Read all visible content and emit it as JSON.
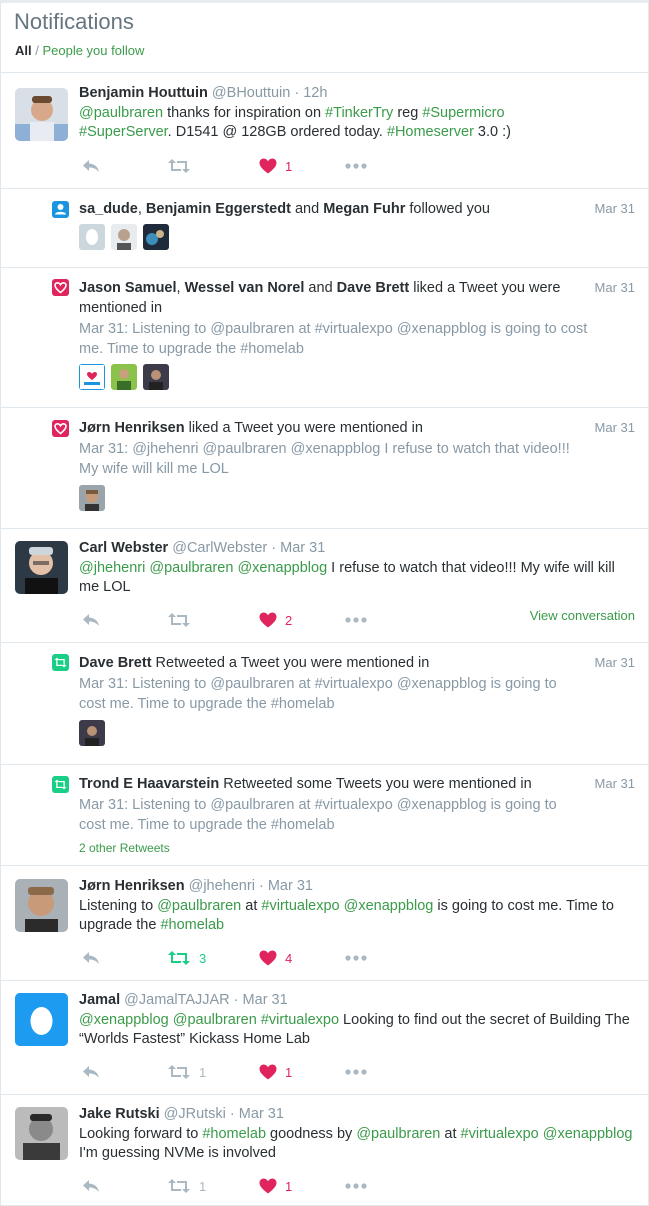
{
  "header": {
    "title": "Notifications",
    "filter_all": "All",
    "filter_sep": " / ",
    "filter_follow": "People you follow"
  },
  "colors": {
    "accent": "#3a9b4a",
    "like": "#e0245e",
    "retweet": "#19cf86",
    "follow": "#1b95e0"
  },
  "tweet1": {
    "name": "Benjamin Houttuin",
    "handle": "@BHouttuin",
    "dot": " · ",
    "time": "12h",
    "t1": "@paulbraren",
    "t2": " thanks for inspiration on ",
    "t3": "#TinkerTry",
    "t4": " reg ",
    "t5": "#Supermicro",
    "t6": "#SuperServer",
    "t7": ". D1541 @ 128GB ordered today. ",
    "t8": "#Homeserver",
    "t9": " 3.0 :)",
    "likes": "1"
  },
  "follow1": {
    "n1": "sa_dude",
    "s1": ", ",
    "n2": "Benjamin Eggerstedt",
    "s2": " and ",
    "n3": "Megan Fuhr",
    "s3": " followed you",
    "date": "Mar 31"
  },
  "like1": {
    "n1": "Jason Samuel",
    "s1": ", ",
    "n2": "Wessel van Norel",
    "s2": " and ",
    "n3": "Dave Brett",
    "s3": " liked a Tweet you were mentioned in",
    "date": "Mar 31",
    "q1": "Mar 31: Listening to ",
    "q2": "@paulbraren",
    "q3": " at ",
    "q4": "#virtualexpo",
    "q5": " ",
    "q6": "@xenappblog",
    "q7": " is going to cost me. Time to upgrade the ",
    "q8": "#homelab"
  },
  "like2": {
    "n1": "Jørn Henriksen",
    "s1": " liked a Tweet you were mentioned in",
    "date": "Mar 31",
    "q1": "Mar 31: ",
    "q2": "@jhehenri",
    "q3": " ",
    "q4": "@paulbraren",
    "q5": " ",
    "q6": "@xenappblog",
    "q7": " I refuse to watch that video!!! My wife will kill me LOL"
  },
  "tweet2": {
    "name": "Carl Webster",
    "handle": "@CarlWebster",
    "dot": " · ",
    "time": "Mar 31",
    "t1": "@jhehenri",
    "t2": " ",
    "t3": "@paulbraren",
    "t4": " ",
    "t5": "@xenappblog",
    "t6": " I refuse to watch that video!!! My wife will kill me LOL",
    "likes": "2",
    "view_conversation": "View conversation"
  },
  "rt1": {
    "n1": "Dave Brett",
    "s1": " Retweeted a Tweet you were mentioned in",
    "date": "Mar 31",
    "q1": "Mar 31: Listening to ",
    "q2": "@paulbraren",
    "q3": " at ",
    "q4": "#virtualexpo",
    "q5": " ",
    "q6": "@xenappblog",
    "q7": " is going to cost me. Time to upgrade the ",
    "q8": "#homelab"
  },
  "rt2": {
    "n1": "Trond E Haavarstein",
    "s1": " Retweeted some Tweets you were mentioned in",
    "date": "Mar 31",
    "q1": "Mar 31: Listening to ",
    "q2": "@paulbraren",
    "q3": " at ",
    "q4": "#virtualexpo",
    "q5": " ",
    "q6": "@xenappblog",
    "q7": " is going to cost me. Time to upgrade the ",
    "q8": "#homelab",
    "other": "2 other Retweets"
  },
  "tweet3": {
    "name": "Jørn Henriksen",
    "handle": "@jhehenri",
    "dot": " · ",
    "time": "Mar 31",
    "t1": "Listening to ",
    "t2": "@paulbraren",
    "t3": " at ",
    "t4": "#virtualexpo",
    "t5": " ",
    "t6": "@xenappblog",
    "t7": " is going to cost me. Time to upgrade the ",
    "t8": "#homelab",
    "retweets": "3",
    "likes": "4"
  },
  "tweet4": {
    "name": "Jamal",
    "handle": "@JamalTAJJAR",
    "dot": " · ",
    "time": "Mar 31",
    "t1": "@xenappblog",
    "t2": " ",
    "t3": "@paulbraren",
    "t4": " ",
    "t5": "#virtualexpo",
    "t6": " Looking to find out the secret of Building The “Worlds Fastest” Kickass Home Lab",
    "retweets": "1",
    "likes": "1"
  },
  "tweet5": {
    "name": "Jake Rutski",
    "handle": "@JRutski",
    "dot": " · ",
    "time": "Mar 31",
    "t1": "Looking forward to ",
    "t2": "#homelab",
    "t3": " goodness by ",
    "t4": "@paulbraren",
    "t5": " at ",
    "t6": "#virtualexpo",
    "t7": " ",
    "t8": "@xenappblog",
    "t9": " I'm guessing NVMe is involved",
    "retweets": "1",
    "likes": "1"
  }
}
